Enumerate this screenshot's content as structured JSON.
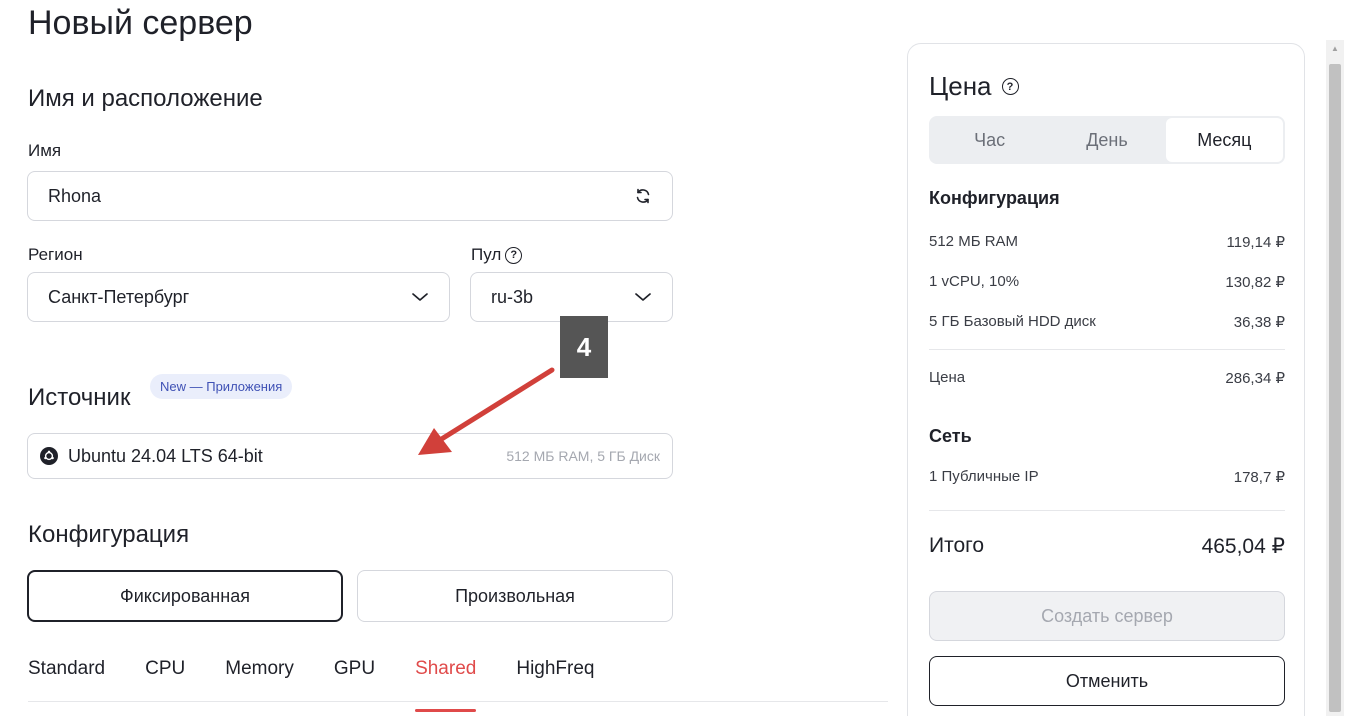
{
  "page": {
    "title": "Новый сервер"
  },
  "name_location": {
    "section_title": "Имя и расположение",
    "name_label": "Имя",
    "name_value": "Rhona",
    "region_label": "Регион",
    "region_value": "Санкт-Петербург",
    "pool_label": "Пул",
    "pool_value": "ru-3b"
  },
  "source": {
    "section_title": "Источник",
    "badge": "New — Приложения",
    "os_name": "Ubuntu 24.04 LTS 64-bit",
    "os_meta": "512 МБ RAM, 5 ГБ Диск",
    "os_icon": "ubuntu-icon"
  },
  "annotation": {
    "label": "4"
  },
  "configuration": {
    "section_title": "Конфигурация",
    "fixed_label": "Фиксированная",
    "custom_label": "Произвольная",
    "tabs": [
      "Standard",
      "CPU",
      "Memory",
      "GPU",
      "Shared",
      "HighFreq"
    ],
    "active_tab": "Shared"
  },
  "price": {
    "title": "Цена",
    "periods": [
      "Час",
      "День",
      "Месяц"
    ],
    "active_period": "Месяц",
    "config_title": "Конфигурация",
    "config_items": [
      {
        "name": "512 МБ RAM",
        "price": "119,14 ₽"
      },
      {
        "name": "1 vCPU, 10%",
        "price": "130,82 ₽"
      },
      {
        "name": "5 ГБ Базовый HDD диск",
        "price": "36,38 ₽"
      }
    ],
    "subtotal_label": "Цена",
    "subtotal_value": "286,34 ₽",
    "network_title": "Сеть",
    "network_items": [
      {
        "name": "1 Публичные IP",
        "price": "178,7 ₽"
      }
    ],
    "total_label": "Итого",
    "total_value": "465,04 ₽",
    "create_label": "Создать сервер",
    "cancel_label": "Отменить"
  },
  "colors": {
    "accent_red": "#e04a4a",
    "text_dark": "#1f2129",
    "badge_bg": "#eaeefb",
    "badge_text": "#3f51b5",
    "annotation_bg": "#555555",
    "arrow": "#d1403a"
  }
}
